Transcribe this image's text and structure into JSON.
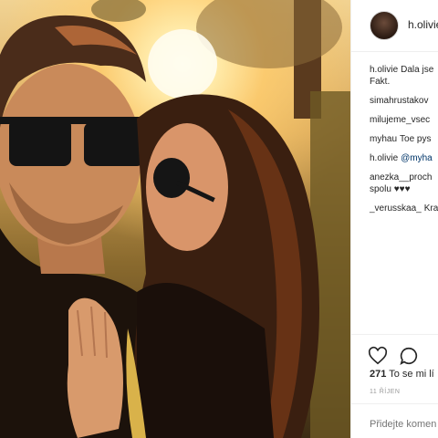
{
  "post": {
    "username": "h.olivie",
    "caption_text": "Dala jse",
    "caption_text2": "Fakt."
  },
  "comments": [
    {
      "user": "simahrustakov",
      "text": ""
    },
    {
      "user": "milujeme_vsec",
      "text": ""
    },
    {
      "user": "myhau",
      "text": "Toe pys"
    },
    {
      "user": "h.olivie",
      "mention": "@myha",
      "text": ""
    },
    {
      "user": "anezka__proch",
      "text": "",
      "line2": "spolu",
      "hearts": "♥♥♥"
    },
    {
      "user": "_verusskaa_",
      "text": "Kra"
    }
  ],
  "actions": {
    "like_icon": "heart-outline-icon",
    "comment_icon": "comment-bubble-icon"
  },
  "likes": {
    "count": "271",
    "label": "To se mi lí"
  },
  "date": "11 ŘÍJEN",
  "add_comment": {
    "placeholder": "Přidejte komen"
  }
}
